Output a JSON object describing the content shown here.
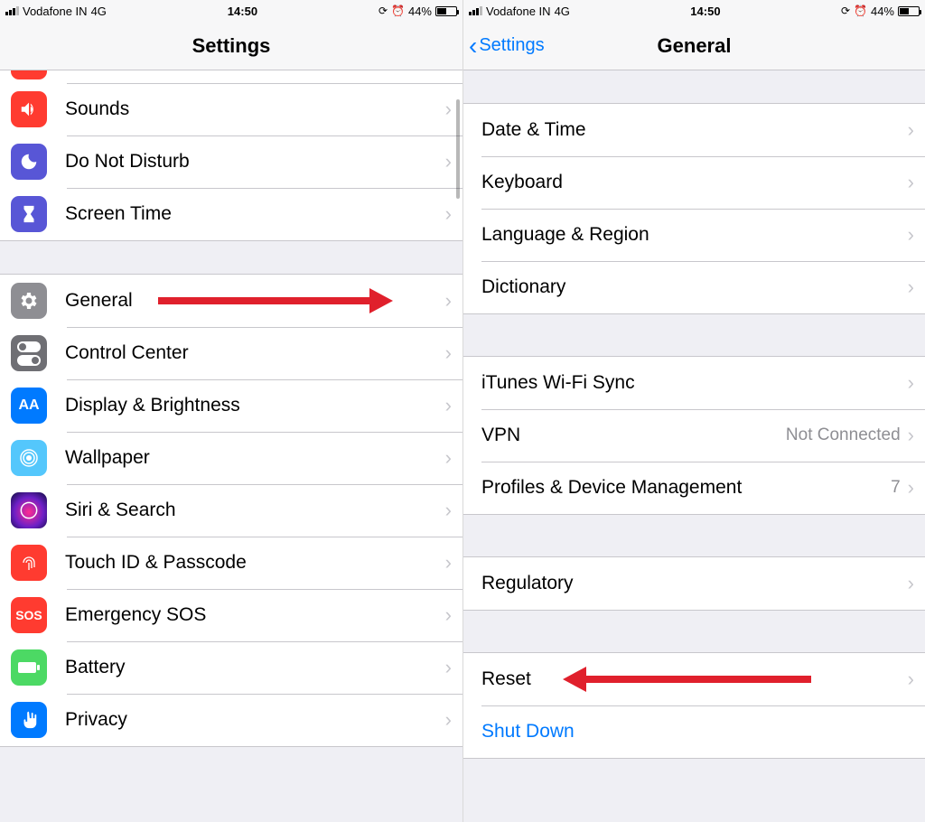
{
  "status": {
    "carrier": "Vodafone IN",
    "network": "4G",
    "time": "14:50",
    "battery_pct": "44%"
  },
  "left": {
    "title": "Settings",
    "group1": [
      {
        "label": "Sounds",
        "icon": "sounds-icon"
      },
      {
        "label": "Do Not Disturb",
        "icon": "dnd-icon"
      },
      {
        "label": "Screen Time",
        "icon": "screentime-icon"
      }
    ],
    "group2": [
      {
        "label": "General",
        "icon": "general-icon"
      },
      {
        "label": "Control Center",
        "icon": "controlcenter-icon"
      },
      {
        "label": "Display & Brightness",
        "icon": "display-icon"
      },
      {
        "label": "Wallpaper",
        "icon": "wallpaper-icon"
      },
      {
        "label": "Siri & Search",
        "icon": "siri-icon"
      },
      {
        "label": "Touch ID & Passcode",
        "icon": "touchid-icon"
      },
      {
        "label": "Emergency SOS",
        "icon": "sos-icon",
        "icon_text": "SOS"
      },
      {
        "label": "Battery",
        "icon": "battery-icon"
      },
      {
        "label": "Privacy",
        "icon": "privacy-icon"
      }
    ]
  },
  "right": {
    "back": "Settings",
    "title": "General",
    "group1": [
      {
        "label": "Date & Time"
      },
      {
        "label": "Keyboard"
      },
      {
        "label": "Language & Region"
      },
      {
        "label": "Dictionary"
      }
    ],
    "group2": [
      {
        "label": "iTunes Wi-Fi Sync"
      },
      {
        "label": "VPN",
        "detail": "Not Connected"
      },
      {
        "label": "Profiles & Device Management",
        "detail": "7"
      }
    ],
    "group3": [
      {
        "label": "Regulatory"
      }
    ],
    "group4": [
      {
        "label": "Reset"
      },
      {
        "label": "Shut Down",
        "style": "link",
        "no_chevron": true
      }
    ]
  },
  "annotation": {
    "left_arrow_target": "General",
    "right_arrow_target": "Reset"
  }
}
